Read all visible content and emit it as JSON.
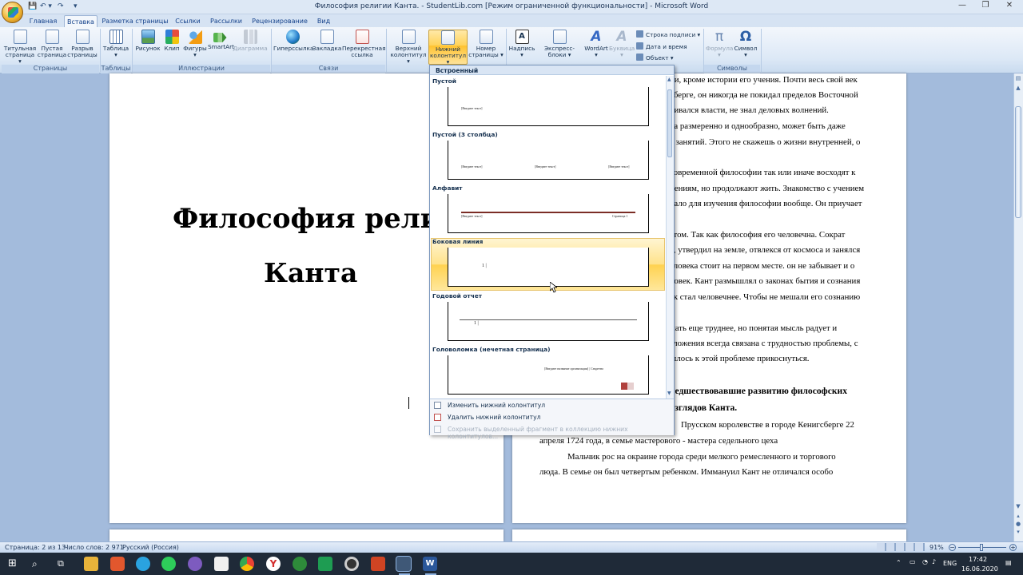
{
  "window": {
    "title": "Философия религии Канта. - StudentLib.com [Режим ограниченной функциональности] - Microsoft Word",
    "min": "—",
    "max": "❐",
    "close": "✕"
  },
  "qat": {
    "save": "💾",
    "undo": "↶ ▾",
    "redo": "↷",
    "more": "▾"
  },
  "tabs": [
    "Главная",
    "Вставка",
    "Разметка страницы",
    "Ссылки",
    "Рассылки",
    "Рецензирование",
    "Вид"
  ],
  "ribbon": {
    "groups": [
      "Страницы",
      "Таблицы",
      "Иллюстрации",
      "Связи",
      "Символы"
    ],
    "pages": [
      "Титульная страница ▾",
      "Пустая страница",
      "Разрыв страницы"
    ],
    "table": "Таблица ▾",
    "illus": [
      "Рисунок",
      "Клип",
      "Фигуры ▾",
      "SmartArt",
      "Диаграмма"
    ],
    "links": [
      "Гиперссылка",
      "Закладка",
      "Перекрестная ссылка"
    ],
    "hf": [
      "Верхний колонтитул ▾",
      "Нижний колонтитул ▾",
      "Номер страницы ▾"
    ],
    "text": [
      "Надпись ▾",
      "Экспресс-блоки ▾",
      "WordArt ▾",
      "Буквица ▾"
    ],
    "text_small": [
      "Строка подписи ▾",
      "Дата и время",
      "Объект ▾"
    ],
    "symbols": [
      "Формула ▾",
      "Символ ▾"
    ]
  },
  "gallery": {
    "header": "Встроенный",
    "items": [
      "Пустой",
      "Пустой (3 столбца)",
      "Алфавит",
      "Боковая линия",
      "Годовой отчет",
      "Головоломка (нечетная страница)"
    ],
    "ph_text": "[Введите текст]",
    "ph_page": "Страница 1",
    "ph_org": "[Введите название организации] | Секретно",
    "ph_num": "1 |",
    "footer": [
      "Изменить нижний колонтитул",
      "Удалить нижний колонтитул",
      "Сохранить выделенный фрагмент в коллекцию нижних колонтитулов..."
    ]
  },
  "doc": {
    "title_line1": "Философия религи",
    "title_line2": "Канта",
    "right": [
      "ни, кроме истории его учения. Почти весь свой век",
      "сберге, он никогда не покидал пределов Восточной",
      "бивался власти, не знал деловых волнений.",
      "ла размеренно и однообразно, может быть даже",
      "а занятий. Этого не скажешь о жизни внутренней, о",
      "современной философии так или иначе восходят к",
      "нениям, но продолжают жить. Знакомство с учением",
      "чало для изучения философии вообще. Он приучает",
      "атом. Так как философия его человечна. Сократ",
      "с, утвердил на земле, отвлекся от космоса и занялся",
      "еловека стоит на первом месте. он не забывает и о",
      "ловек. Кант размышлял о законах бытия и сознания",
      "ек стал человечнее. Чтобы не мешали его сознанию",
      "мать еще труднее, но понятая мысль радует и",
      "зложения всегда связана с трудностью проблемы, с",
      "шлось к этой проблеме прикоснуться."
    ],
    "heading1": "редшествовавшие развитию философских",
    "heading2": "взглядов Канта.",
    "p1a": "Прусском королевстве в городе Кенигсберге 22",
    "p1b": "апреля 1724 года, в семье мастерового - мастера седельного цеха",
    "p2a": "Мальчик рос на окраине города среди мелкого ремесленного и торгового",
    "p2b": "люда. В семье он был четвертым ребенком. Иммануил Кант не отличался особо"
  },
  "status": {
    "page": "Страница: 2 из 13",
    "words": "Число слов: 2 971",
    "lang": "Русский (Россия)",
    "zoom": "91%"
  },
  "taskbar": {
    "lang": "ENG",
    "time": "17:42",
    "date": "16.06.2020"
  }
}
